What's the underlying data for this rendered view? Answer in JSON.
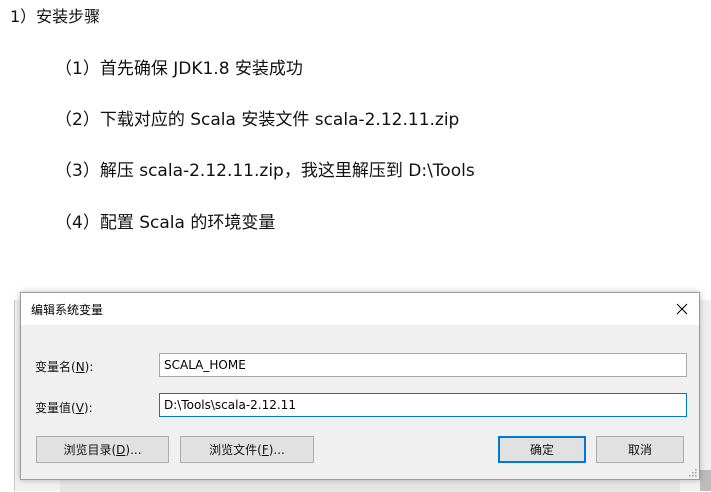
{
  "document": {
    "step_title": "1）安装步骤",
    "items": [
      "（1）首先确保 JDK1.8 安装成功",
      "（2）下载对应的 Scala 安装文件 scala-2.12.11.zip",
      "（3）解压 scala-2.12.11.zip，我这里解压到 D:\\Tools",
      "（4）配置 Scala 的环境变量"
    ]
  },
  "dialog": {
    "title": "编辑系统变量",
    "close_icon": "close-icon",
    "fields": {
      "name_label_prefix": "变量名(",
      "name_label_key": "N",
      "name_label_suffix": "):",
      "name_value": "SCALA_HOME",
      "value_label_prefix": "变量值(",
      "value_label_key": "V",
      "value_label_suffix": "):",
      "value_value": "D:\\Tools\\scala-2.12.11"
    },
    "buttons": {
      "browse_dir_prefix": "浏览目录(",
      "browse_dir_key": "D",
      "browse_dir_suffix": ")...",
      "browse_file_prefix": "浏览文件(",
      "browse_file_key": "F",
      "browse_file_suffix": ")...",
      "ok": "确定",
      "cancel": "取消"
    },
    "colors": {
      "focus_border": "#0078d7",
      "dialog_bg": "#f0f0f0"
    }
  }
}
